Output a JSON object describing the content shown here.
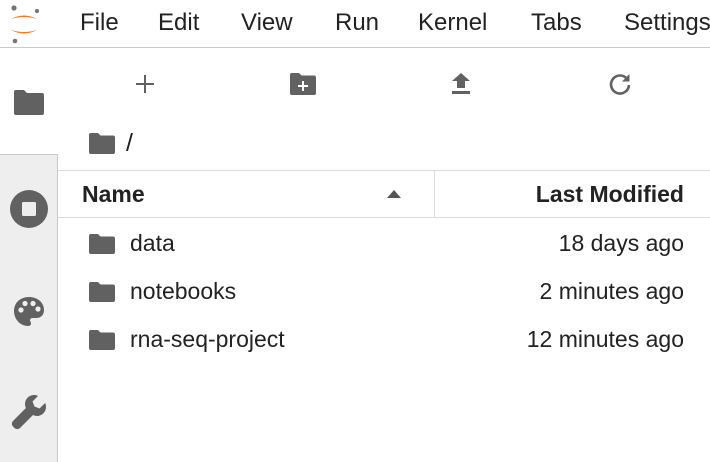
{
  "menu": [
    "File",
    "Edit",
    "View",
    "Run",
    "Kernel",
    "Tabs",
    "Settings"
  ],
  "sidebar": {
    "tabs": [
      {
        "icon": "folder-icon",
        "active": true
      },
      {
        "icon": "stop-circle-icon",
        "active": false
      },
      {
        "icon": "palette-icon",
        "active": false
      },
      {
        "icon": "wrench-icon",
        "active": false
      }
    ]
  },
  "toolbar": {
    "new_launcher_icon": "plus-icon",
    "new_folder_icon": "new-folder-icon",
    "upload_icon": "upload-icon",
    "refresh_icon": "refresh-icon"
  },
  "breadcrumb": {
    "root": "/"
  },
  "listing": {
    "header": {
      "name": "Name",
      "modified": "Last Modified",
      "sort": "ascending"
    },
    "items": [
      {
        "name": "data",
        "modified": "18 days ago",
        "type": "folder"
      },
      {
        "name": "notebooks",
        "modified": "2 minutes ago",
        "type": "folder"
      },
      {
        "name": "rna-seq-project",
        "modified": "12 minutes ago",
        "type": "folder"
      }
    ]
  },
  "colors": {
    "brand_orange": "#f37726",
    "icon_gray": "#616161",
    "sidebar_bg": "#eeeeee"
  }
}
